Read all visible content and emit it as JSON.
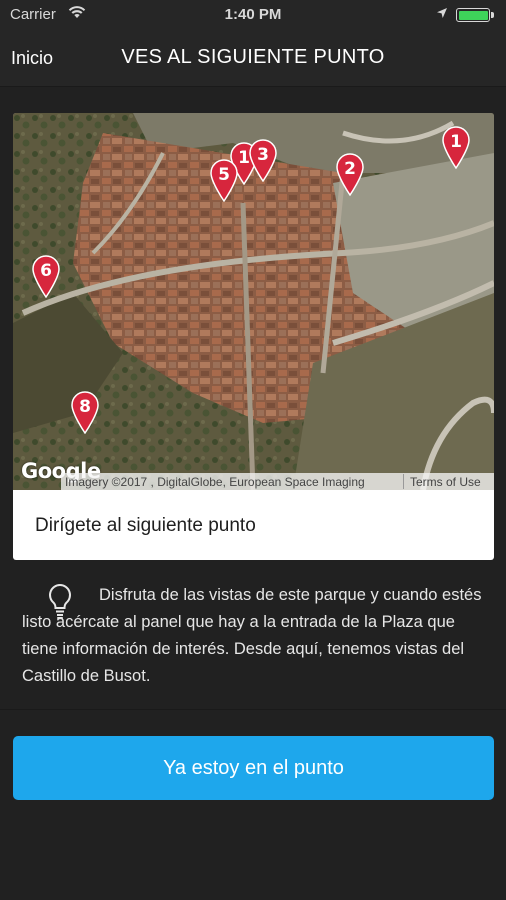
{
  "status_bar": {
    "carrier": "Carrier",
    "time": "1:40 PM",
    "icons": [
      "wifi-icon",
      "location-arrow-icon",
      "battery-icon"
    ],
    "battery_color": "#3ed35a"
  },
  "nav": {
    "back_label": "Inicio",
    "title": "VES AL SIGUIENTE PUNTO"
  },
  "map": {
    "markers": [
      "1",
      "2",
      "3",
      "1",
      "5",
      "6",
      "8"
    ],
    "marker_color": "#d7263d",
    "logo": "Google",
    "imagery_credit": "Imagery ©2017 , DigitalGlobe, European Space Imaging",
    "terms_link": "Terms of Use"
  },
  "card": {
    "instruction": "Dirígete al siguiente punto"
  },
  "tip": {
    "icon": "lightbulb-icon",
    "text": "Disfruta de las vistas de este parque y cuando estés listo acércate al panel que hay a la entrada de la Plaza que tiene información de interés. Desde aquí, tenemos vistas del Castillo de Busot."
  },
  "action": {
    "label": "Ya estoy en el punto",
    "color": "#1ea7ec"
  }
}
